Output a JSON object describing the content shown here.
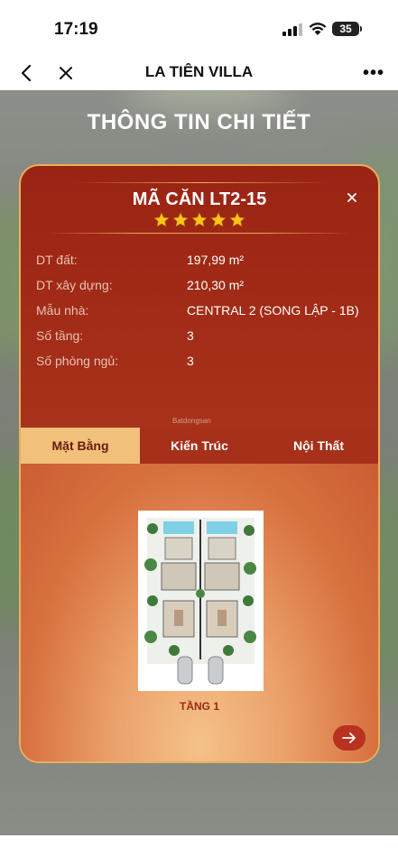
{
  "status_bar": {
    "time": "17:19",
    "battery": "35"
  },
  "nav": {
    "title": "LA TIÊN VILLA",
    "more_label": "•••"
  },
  "page": {
    "heading": "THÔNG TIN CHI TIẾT"
  },
  "card": {
    "title": "MÃ CĂN LT2-15",
    "rating": 5,
    "details": [
      {
        "label": "DT đất:",
        "value": "197,99 m²"
      },
      {
        "label": "DT xây dựng:",
        "value": "210,30 m²"
      },
      {
        "label": "Mẫu nhà:",
        "value": "CENTRAL 2 (SONG LẬP - 1B)"
      },
      {
        "label": "Số tầng:",
        "value": "3"
      },
      {
        "label": "Số phòng ngủ:",
        "value": "3"
      }
    ],
    "watermark": "Batdongsan",
    "tabs": [
      {
        "label": "Mặt Bằng",
        "active": true
      },
      {
        "label": "Kiến Trúc",
        "active": false
      },
      {
        "label": "Nội Thất",
        "active": false
      }
    ],
    "floor_label": "TẦNG 1"
  },
  "colors": {
    "card_red": "#9a2413",
    "gold": "#e8b05a",
    "tab_active": "#f1c07a",
    "star": "#ffc21a"
  },
  "icons": {
    "back": "chevron-left-icon",
    "close": "close-icon",
    "more": "more-horizontal-icon",
    "next": "arrow-right-icon",
    "star": "star-icon"
  }
}
